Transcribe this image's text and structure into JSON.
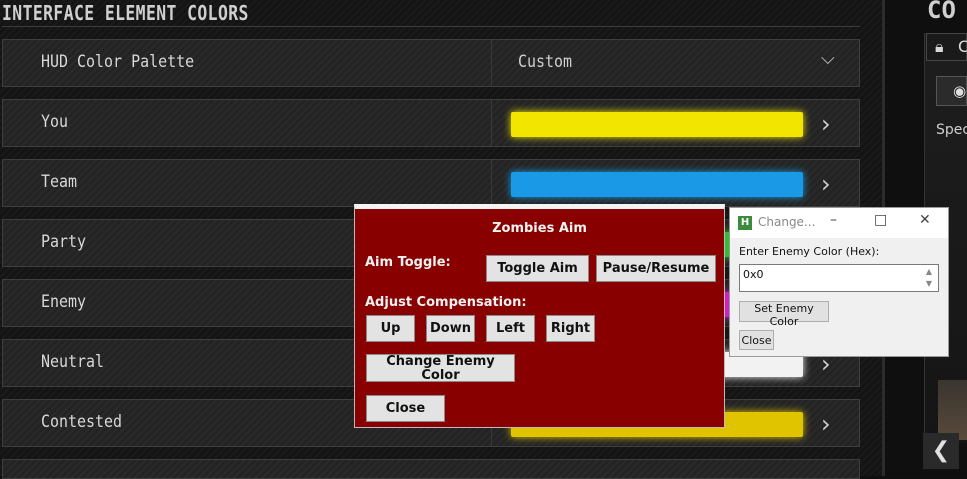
{
  "section_title": "INTERFACE ELEMENT COLORS",
  "rows": [
    {
      "label": "HUD Color Palette",
      "value": "Custom"
    },
    {
      "label": "You",
      "color": "#f2e600"
    },
    {
      "label": "Team",
      "color": "#1a9ae6"
    },
    {
      "label": "Party",
      "color": "#2fbf2f"
    },
    {
      "label": "Enemy",
      "color": "#d020c0"
    },
    {
      "label": "Neutral",
      "color": "#f2f2f2"
    },
    {
      "label": "Contested",
      "color": "#e0c400"
    }
  ],
  "right_panel": {
    "title": "CO",
    "lock_label": "C",
    "spec_label": "Spec"
  },
  "zombies_aim": {
    "title": "Zombies Aim",
    "aim_toggle_label": "Aim Toggle:",
    "toggle_aim": "Toggle Aim",
    "pause_resume": "Pause/Resume",
    "adjust_label": "Adjust Compensation:",
    "up": "Up",
    "down": "Down",
    "left": "Left",
    "right": "Right",
    "change_enemy_line1": "Change Enemy",
    "change_enemy_line2": "Color",
    "close": "Close",
    "bg_color": "#880000"
  },
  "change_dialog": {
    "app_icon": "H",
    "title": "Change...",
    "prompt": "Enter Enemy Color (Hex):",
    "input_value": "0x0",
    "set_button": "Set Enemy Color",
    "close_button": "Close"
  }
}
